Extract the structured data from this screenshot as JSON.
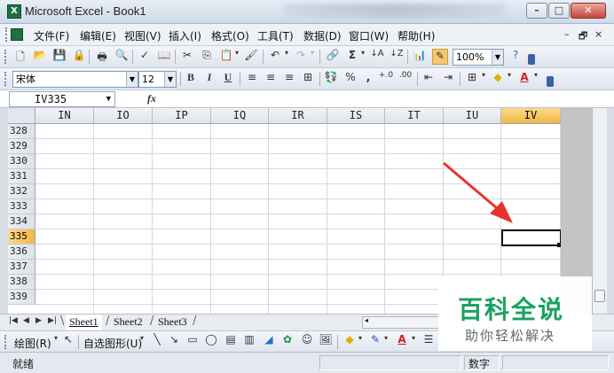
{
  "window": {
    "title": "Microsoft Excel - Book1",
    "app_icon": "excel-icon",
    "controls": {
      "minimize": "–",
      "maximize": "□",
      "close": "✕"
    }
  },
  "menubar": {
    "items": [
      "文件(F)",
      "编辑(E)",
      "视图(V)",
      "插入(I)",
      "格式(O)",
      "工具(T)",
      "数据(D)",
      "窗口(W)",
      "帮助(H)"
    ],
    "mdi_controls": {
      "minimize": "–",
      "restore": "🗗",
      "close": "×"
    }
  },
  "toolbar": {
    "zoom": "100%"
  },
  "format_toolbar": {
    "font_name": "宋体",
    "font_size": "12",
    "bold": "B",
    "italic": "I",
    "underline": "U",
    "percent": "%",
    "comma": ",",
    "inc_decimal": "+.0",
    "dec_decimal": ".00",
    "font_color_label": "A"
  },
  "formula_bar": {
    "name_box": "IV335",
    "fx_label": "fx",
    "value": ""
  },
  "sheet": {
    "columns": [
      "IN",
      "IO",
      "IP",
      "IQ",
      "IR",
      "IS",
      "IT",
      "IU",
      "IV"
    ],
    "active_column": "IV",
    "rows": [
      "328",
      "329",
      "330",
      "331",
      "332",
      "333",
      "334",
      "335",
      "336",
      "337",
      "338",
      "339"
    ],
    "active_row": "335"
  },
  "sheet_tabs": {
    "tabs": [
      "Sheet1",
      "Sheet2",
      "Sheet3"
    ],
    "active": "Sheet1"
  },
  "drawing_toolbar": {
    "draw_menu": "绘图(R)",
    "autoshapes_menu": "自选图形(U)"
  },
  "statusbar": {
    "left": "就绪",
    "num_lock": "数字"
  },
  "watermark": {
    "title": "百科全说",
    "subtitle": "助你轻松解决"
  },
  "colors": {
    "active_header": "#f2b643",
    "arrow": "#e8322d",
    "watermark_green": "#1aa260"
  }
}
